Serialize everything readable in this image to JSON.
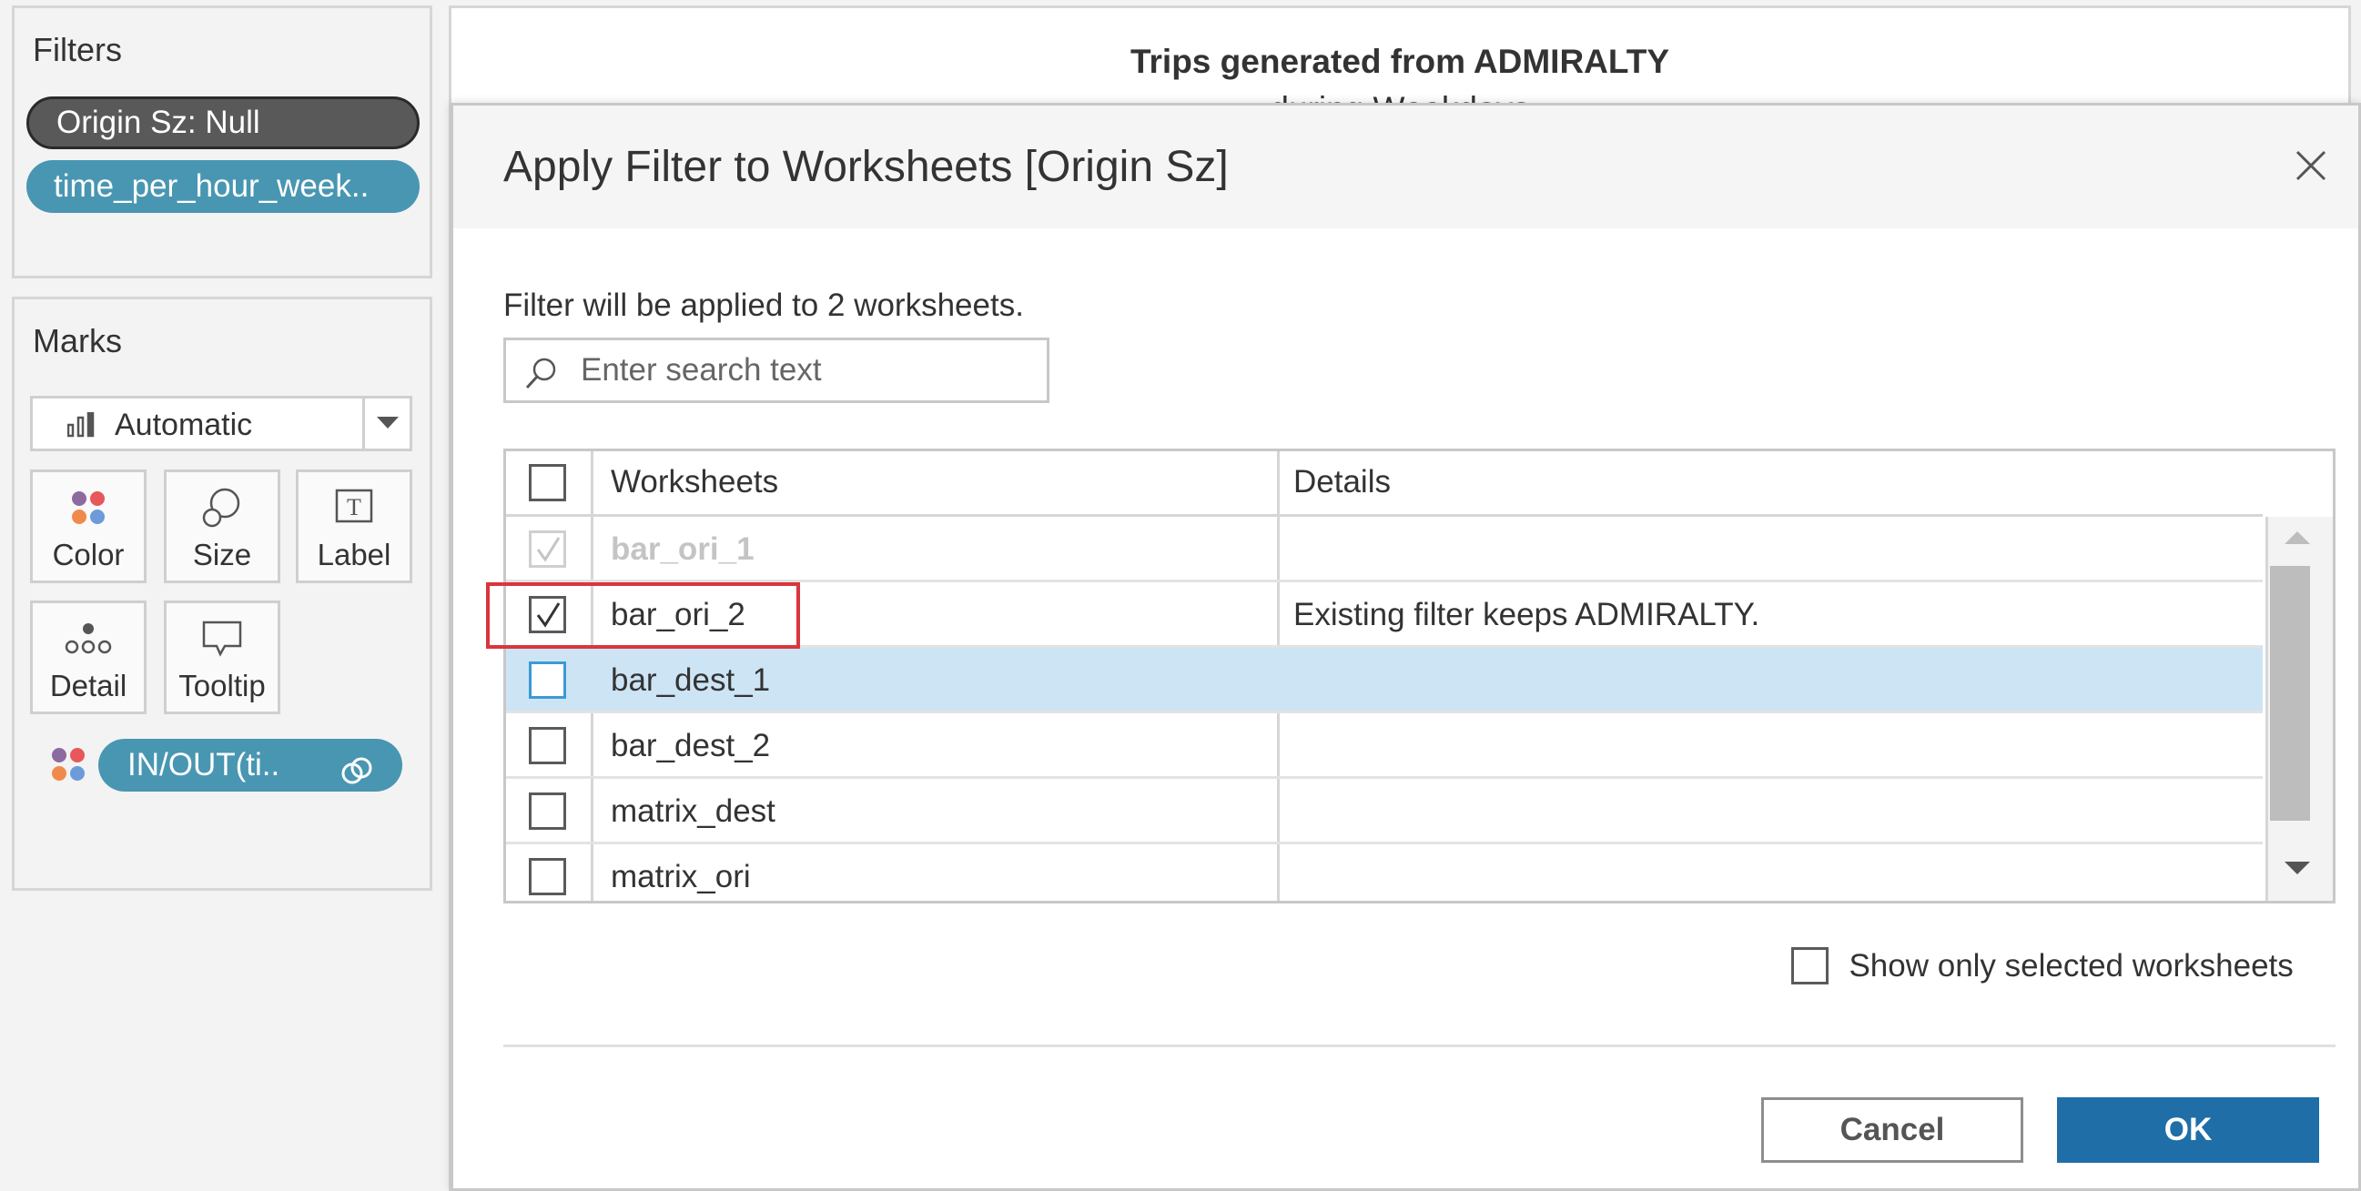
{
  "filters_pane": {
    "title": "Filters",
    "pills": [
      "Origin Sz: Null",
      "time_per_hour_week.."
    ]
  },
  "marks_pane": {
    "title": "Marks",
    "mark_type": "Automatic",
    "buttons": {
      "color": "Color",
      "size": "Size",
      "label": "Label",
      "detail": "Detail",
      "tooltip": "Tooltip"
    },
    "field_pill": "IN/OUT(ti.."
  },
  "worksheet": {
    "title": "Trips generated from ADMIRALTY",
    "subtitle": "during Weekdays"
  },
  "dialog": {
    "title": "Apply Filter to Worksheets [Origin Sz]",
    "info": "Filter will be applied to 2 worksheets.",
    "search_placeholder": "Enter search text",
    "columns": {
      "worksheets": "Worksheets",
      "details": "Details"
    },
    "rows": [
      {
        "name": "bar_ori_1",
        "checked": true,
        "disabled": true,
        "detail": ""
      },
      {
        "name": "bar_ori_2",
        "checked": true,
        "disabled": false,
        "detail": "Existing filter keeps ADMIRALTY."
      },
      {
        "name": "bar_dest_1",
        "checked": false,
        "disabled": false,
        "detail": ""
      },
      {
        "name": "bar_dest_2",
        "checked": false,
        "disabled": false,
        "detail": ""
      },
      {
        "name": "matrix_dest",
        "checked": false,
        "disabled": false,
        "detail": ""
      },
      {
        "name": "matrix_ori",
        "checked": false,
        "disabled": false,
        "detail": ""
      }
    ],
    "show_selected_label": "Show only selected worksheets",
    "cancel_label": "Cancel",
    "ok_label": "OK"
  },
  "colors": {
    "pill_blue": "#4996b2",
    "pill_null": "#595959",
    "ok_button": "#1f6ea8",
    "selected_row": "#cde4f5",
    "highlight": "#d9363e"
  }
}
